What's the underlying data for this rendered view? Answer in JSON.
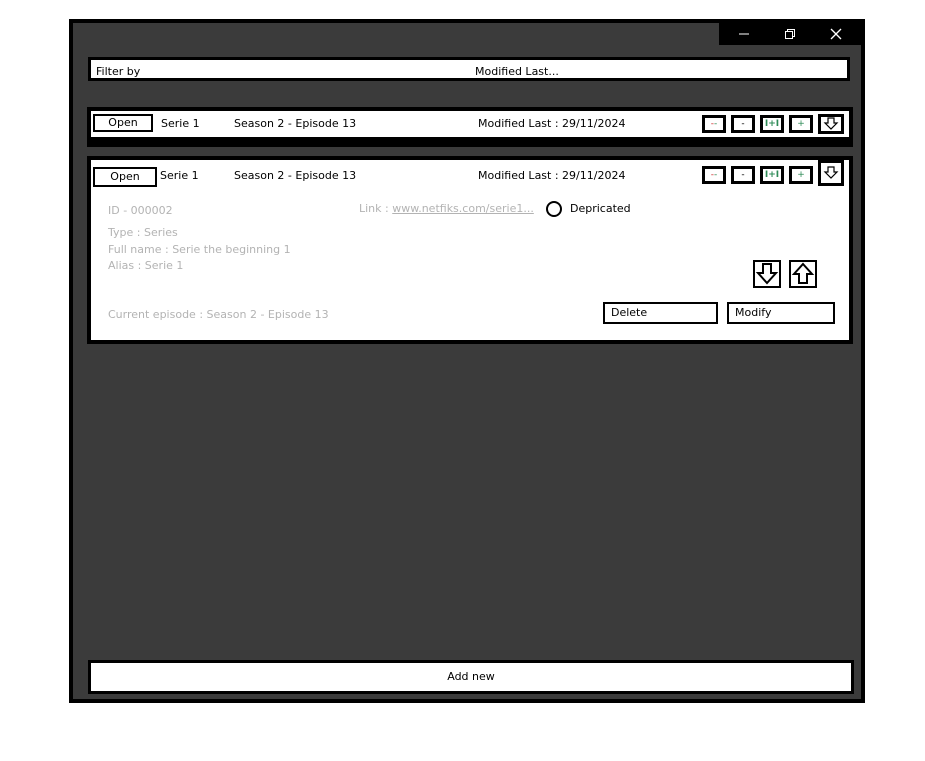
{
  "window": {
    "controls": [
      "minimize-icon",
      "restore-icon",
      "close-icon"
    ]
  },
  "filter": {
    "label": "Filter by",
    "value": "Modified Last..."
  },
  "rows": [
    {
      "open_label": "Open",
      "serie": "Serie 1",
      "episode": "Season 2 - Episode 13",
      "modified": "Modified Last : 29/11/2024",
      "buttons": [
        "--",
        "-",
        "I+I",
        "+",
        "expand"
      ]
    },
    {
      "open_label": "Open",
      "serie": "Serie 1",
      "episode": "Season 2 - Episode 13",
      "modified": "Modified Last : 29/11/2024",
      "buttons": [
        "--",
        "-",
        "I+I",
        "+",
        "expand"
      ],
      "details": {
        "id": "ID - 000002",
        "link_label": "Link :",
        "link_url": "www.netfiks.com/serie1...",
        "deprecated_label": "Depricated",
        "type": "Type : Series",
        "full_name": "Full name : Serie the beginning 1",
        "alias": "Alias : Serie 1",
        "current_episode": "Current episode : Season 2 - Episode 13",
        "delete_label": "Delete",
        "modify_label": "Modify"
      }
    }
  ],
  "footer": {
    "add_new_label": "Add new"
  },
  "colors": {
    "background": "#3b3b3b",
    "panel": "#ffffff",
    "border": "#000000",
    "muted_text": "#b3b3b3",
    "button_accent": "#2e8b57",
    "button_red": "#cc3333"
  }
}
